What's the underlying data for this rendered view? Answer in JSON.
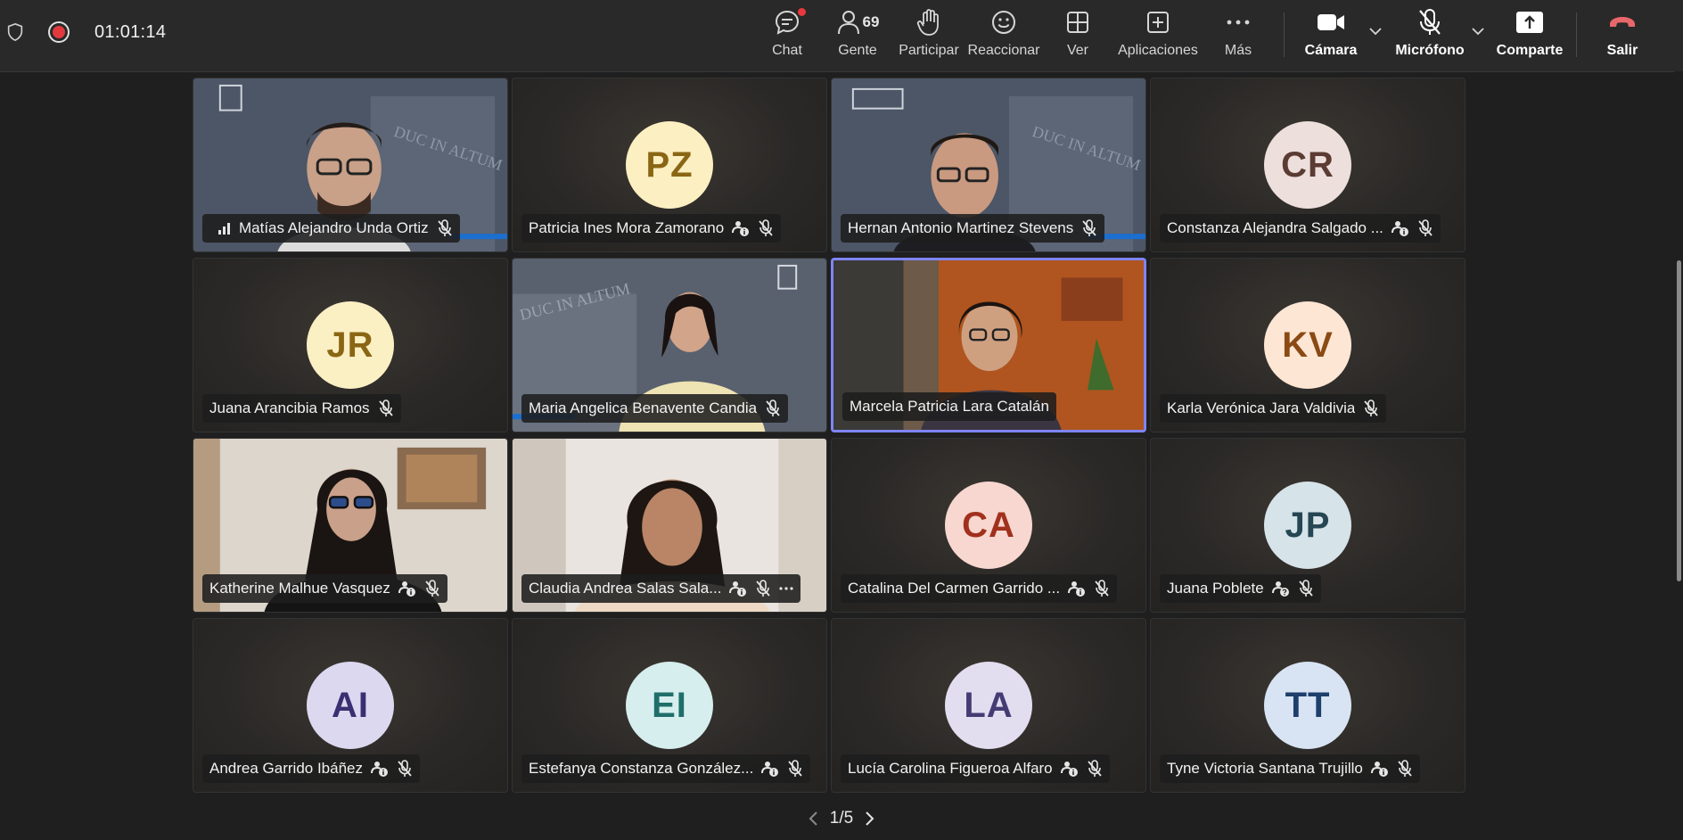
{
  "topbar": {
    "timer": "01:01:14",
    "people_count": "69",
    "buttons": {
      "chat": "Chat",
      "people": "Gente",
      "raise": "Participar",
      "react": "Reaccionar",
      "view": "Ver",
      "apps": "Aplicaciones",
      "more": "Más",
      "camera": "Cámara",
      "mic": "Micrófono",
      "share": "Comparte",
      "leave": "Salir"
    },
    "colors": {
      "recording": "#e03a3e",
      "leave": "#e8676b",
      "notification": "#e8383d"
    }
  },
  "participants": [
    {
      "name": "Matías Alejandro Unda Ortiz",
      "initials": "",
      "video": true
    },
    {
      "name": "Patricia Ines Mora Zamorano",
      "initials": "PZ",
      "avatar_bg": "#fcefc1",
      "avatar_fg": "#8a6614"
    },
    {
      "name": "Hernan Antonio Martinez Stevens",
      "initials": "",
      "video": true
    },
    {
      "name": "Constanza Alejandra Salgado ...",
      "initials": "CR",
      "avatar_bg": "#eddfdb",
      "avatar_fg": "#5b3b33"
    },
    {
      "name": "Juana Arancibia Ramos",
      "initials": "JR",
      "avatar_bg": "#fbefc4",
      "avatar_fg": "#8a6614"
    },
    {
      "name": "Maria Angelica Benavente Candia",
      "initials": "",
      "video": true
    },
    {
      "name": "Marcela Patricia Lara Catalán",
      "initials": "",
      "video": true,
      "speaking": true
    },
    {
      "name": "Karla Verónica Jara Valdivia",
      "initials": "KV",
      "avatar_bg": "#fde6d4",
      "avatar_fg": "#8b4a14"
    },
    {
      "name": "Katherine Malhue Vasquez",
      "initials": "",
      "video": true
    },
    {
      "name": "Claudia Andrea Salas Sala...",
      "initials": "",
      "video": true
    },
    {
      "name": "Catalina Del Carmen Garrido ...",
      "initials": "CA",
      "avatar_bg": "#f7d7cf",
      "avatar_fg": "#a1301d"
    },
    {
      "name": "Juana Poblete",
      "initials": "JP",
      "avatar_bg": "#d6e3e8",
      "avatar_fg": "#264653"
    },
    {
      "name": "Andrea Garrido Ibáñez",
      "initials": "AI",
      "avatar_bg": "#dcd8ef",
      "avatar_fg": "#3a2f72"
    },
    {
      "name": "Estefanya Constanza González...",
      "initials": "EI",
      "avatar_bg": "#d6eeed",
      "avatar_fg": "#1f6e6a"
    },
    {
      "name": "Lucía Carolina Figueroa Alfaro",
      "initials": "LA",
      "avatar_bg": "#e2def0",
      "avatar_fg": "#463c74"
    },
    {
      "name": "Tyne Victoria Santana Trujillo",
      "initials": "TT",
      "avatar_bg": "#d8e4f3",
      "avatar_fg": "#1e3f6b"
    }
  ],
  "pager": {
    "label": "1/5"
  }
}
